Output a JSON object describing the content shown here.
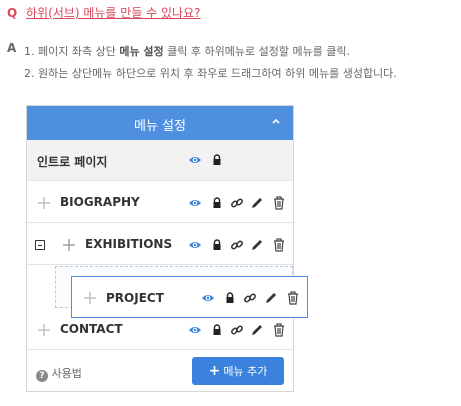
{
  "question": {
    "mark": "Q",
    "text": "하위(서브) 메뉴를 만들 수 있나요?"
  },
  "answer": {
    "mark": "A",
    "line1_prefix": "1. 페이지 좌측 상단 ",
    "line1_bold": "메뉴 설정",
    "line1_suffix": " 클릭 후 하위메뉴로 설정할 메뉴를 클릭.",
    "line2": "2. 원하는 상단메뉴 하단으로 위치 후 좌우로 드래그하여 하위 메뉴를 생성합니다."
  },
  "panel": {
    "title": "메뉴 설정",
    "items": [
      {
        "label": "인트로 페이지"
      },
      {
        "label": "BIOGRAPHY"
      },
      {
        "label": "EXHIBITIONS"
      },
      {
        "label": "PROJECT"
      },
      {
        "label": "CONTACT"
      }
    ],
    "help_label": "사용법",
    "add_button_label": "메뉴 추가"
  },
  "colors": {
    "accent": "#4f8fe0",
    "question": "#d9485a",
    "icon_blue": "#3a82dc"
  }
}
